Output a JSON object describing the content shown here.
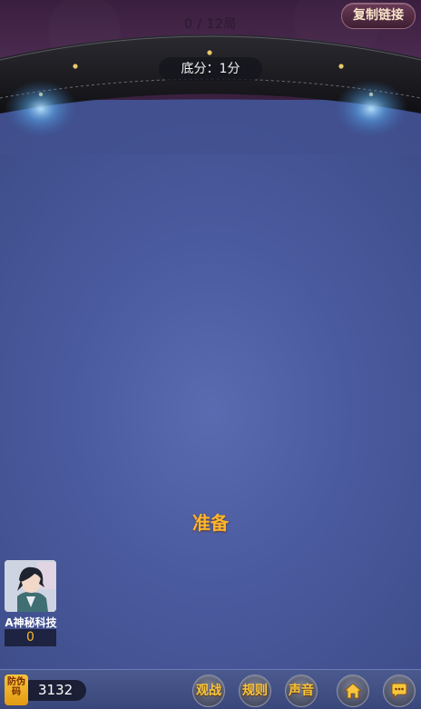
{
  "header": {
    "round_counter": "0 / 12局",
    "copy_link_label": "复制链接",
    "base_score": "底分：1分"
  },
  "table": {
    "ready_label": "准备"
  },
  "player": {
    "name": "A神秘科技",
    "score": "0"
  },
  "bottom_bar": {
    "anti_fake_label": "防伪码",
    "room_number": "3132",
    "buttons": {
      "spectate": "观战",
      "rules": "规则",
      "sound": "声音",
      "home_icon": "home-icon",
      "chat_icon": "chat-icon"
    }
  },
  "colors": {
    "felt": "#4a5a9e",
    "accent_gold": "#ffb52a",
    "top_band": "#3a1e3f"
  }
}
